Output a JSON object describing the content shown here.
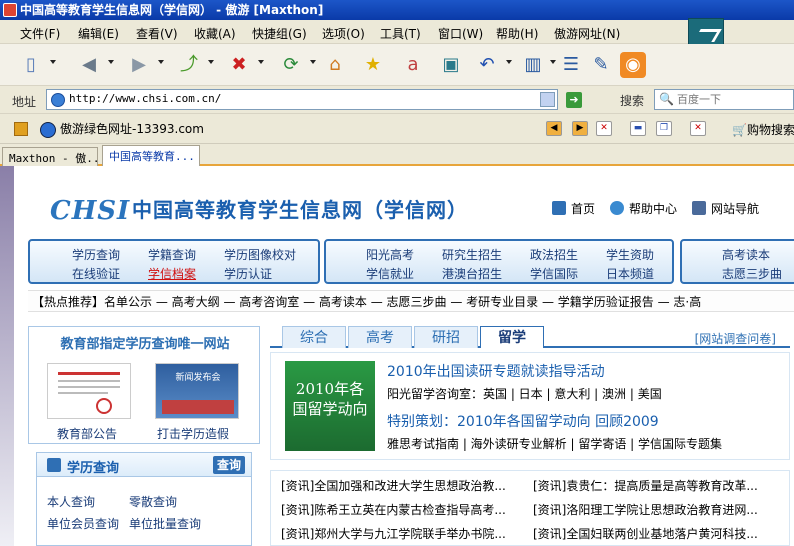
{
  "window": {
    "title": "中国高等教育学生信息网（学信网） - 傲游 [Maxthon]"
  },
  "menu": [
    "文件(F)",
    "编辑(E)",
    "查看(V)",
    "收藏(A)",
    "快捷组(G)",
    "选项(O)",
    "工具(T)",
    "窗口(W)",
    "帮助(H)",
    "傲游网址(N)"
  ],
  "address": {
    "label": "地址",
    "url": "http://www.chsi.com.cn/"
  },
  "search": {
    "label": "搜索",
    "placeholder": "百度一下"
  },
  "favbar": {
    "link": "傲游绿色网址-13393.com",
    "shopping": "购物搜索"
  },
  "tabs": [
    "Maxthon - 傲...",
    "中国高等教育..."
  ],
  "site": {
    "logo": "CHSI",
    "name": "中国高等教育学生信息网（学信网）",
    "topnav": [
      "首页",
      "帮助中心",
      "网站导航"
    ],
    "nav1": [
      "学历查询",
      "学籍查询",
      "学历图像校对",
      "在线验证",
      "学信档案",
      "学历认证"
    ],
    "nav2": [
      "阳光高考",
      "研究生招生",
      "政法招生",
      "学生资助",
      "学信就业",
      "港澳台招生",
      "学信国际",
      "日本频道"
    ],
    "nav3": [
      "高考读本",
      "志愿三步曲"
    ],
    "hotline": "【热点推荐】名单公示 — 高考大纲 — 高考咨询室 — 高考读本 — 志愿三步曲 — 考研专业目录 — 学籍学历验证报告 — 志·高",
    "left": {
      "header": "教育部指定学历查询唯一网站",
      "cap1": "教育部公告",
      "cap2": "打击学历造假",
      "thumb2_text": "新闻发布会",
      "query_title": "学历查询",
      "query_btn": "查询",
      "q": [
        "本人查询",
        "零散查询",
        "单位会员查询",
        "单位批量查询"
      ]
    },
    "main": {
      "tabs": [
        "综合",
        "高考",
        "研招",
        "留学"
      ],
      "survey": "[网站调查问卷]",
      "image_text": "2010年各国留学动向",
      "headline1": "2010年出国读研专题就读指导活动",
      "line1": "阳光留学咨询室：英国 | 日本 | 意大利 | 澳洲 | 美国",
      "headline2": "特别策划：2010年各国留学动向 回顾2009",
      "line2": "雅思考试指南 | 海外读研专业解析 | 留学寄语 | 学信国际专题集",
      "news": [
        "[资讯]全国加强和改进大学生思想政治教...",
        "[资讯]袁贵仁：提高质量是高等教育改革...",
        "[资讯]陈希王立英在内蒙古检查指导高考...",
        "[资讯]洛阳理工学院让思想政治教育进网...",
        "[资讯]郑州大学与九江学院联手举办书院...",
        "[资讯]全国妇联两创业基地落户黄河科技..."
      ]
    }
  },
  "colors": {
    "titlebar": "#1c56c8",
    "accent": "#2f6fb4",
    "hot": "#d01010"
  }
}
